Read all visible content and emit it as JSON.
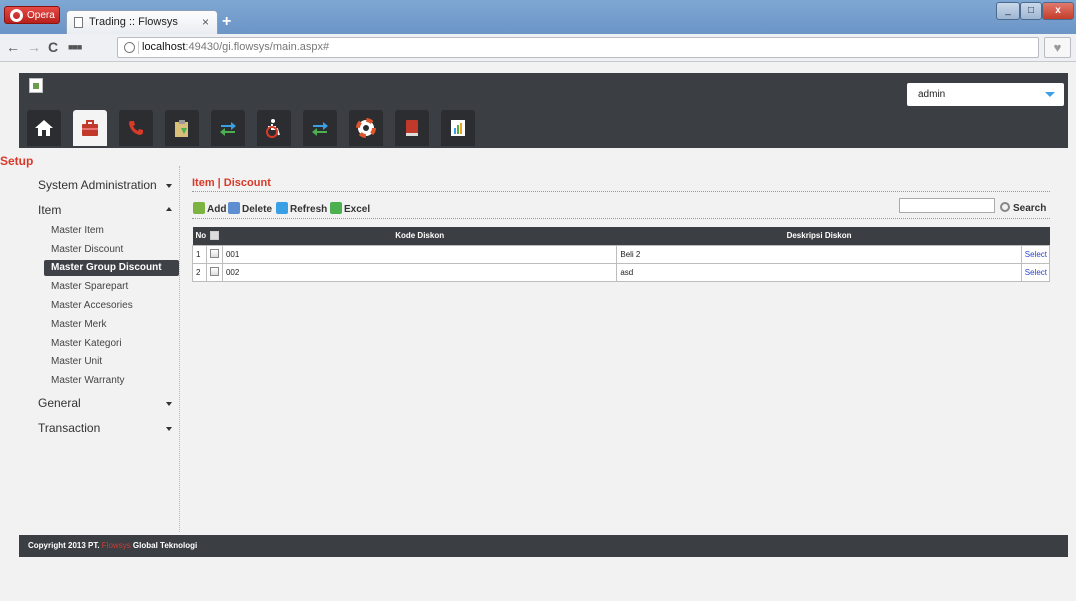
{
  "browser": {
    "menu_label": "Opera",
    "tab_title": "Trading :: Flowsys",
    "tab_close": "×",
    "new_tab": "+",
    "url_host": "localhost",
    "url_path": ":49430/gi.flowsys/main.aspx#",
    "window_controls": [
      "_",
      "□",
      "x"
    ]
  },
  "header": {
    "user": "admin",
    "menu_icons": [
      "home-icon",
      "briefcase-icon",
      "phone-icon",
      "clipboard-icon",
      "exchange-icon",
      "accessibility-icon",
      "transfer-icon",
      "lifebuoy-icon",
      "book-icon",
      "report-icon"
    ],
    "active_index": 1
  },
  "section_label": "Setup",
  "sidebar": {
    "groups": [
      {
        "label": "System Administration",
        "expanded": false
      },
      {
        "label": "Item",
        "expanded": true,
        "items": [
          "Master Item",
          "Master Discount",
          "Master Group Discount",
          "Master Sparepart",
          "Master Accesories",
          "Master Merk",
          "Master Kategori",
          "Master Unit",
          "Master Warranty"
        ],
        "active_item": "Master Group Discount"
      },
      {
        "label": "General",
        "expanded": false
      },
      {
        "label": "Transaction",
        "expanded": false
      }
    ]
  },
  "content": {
    "title": "Item | Discount",
    "toolbar": {
      "add": "Add",
      "delete": "Delete",
      "refresh": "Refresh",
      "excel": "Excel",
      "search": "Search"
    },
    "search_value": "",
    "table": {
      "columns": [
        "No",
        "Kode Diskon",
        "Deskripsi Diskon",
        ""
      ],
      "rows": [
        {
          "no": "1",
          "kode": "001",
          "deskripsi": "Beli 2",
          "action": "Select"
        },
        {
          "no": "2",
          "kode": "002",
          "deskripsi": "asd",
          "action": "Select"
        }
      ]
    }
  },
  "footer": {
    "prefix": "Copyright 2013 PT. ",
    "brand": "Flowsys",
    "suffix": " Global Teknologi"
  },
  "colors": {
    "accent_red": "#d83a2a",
    "header_dark": "#3b3e43",
    "link_blue": "#2a43c9"
  }
}
